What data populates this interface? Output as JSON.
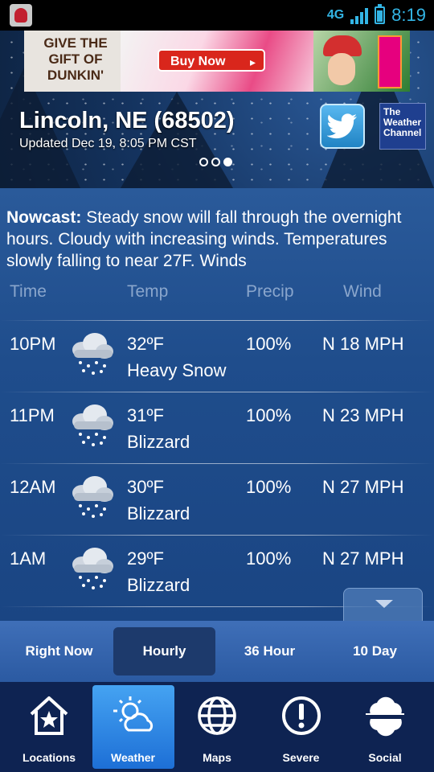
{
  "status_bar": {
    "network": "4G",
    "time": "8:19"
  },
  "ad": {
    "headline": "GIVE THE GIFT OF DUNKIN'",
    "button": "Buy Now"
  },
  "location": {
    "city": "Lincoln, NE (68502)",
    "updated": "Updated Dec 19, 8:05 PM CST",
    "page_count": 3,
    "active_page": 3
  },
  "brand": {
    "twc_line1": "The",
    "twc_line2": "Weather",
    "twc_line3": "Channel"
  },
  "nowcast": {
    "label": "Nowcast:",
    "text": "Steady snow will fall through the overnight hours. Cloudy with increasing winds. Temperatures slowly falling to near 27F. Winds"
  },
  "columns": {
    "time": "Time",
    "temp": "Temp",
    "precip": "Precip",
    "wind": "Wind"
  },
  "hourly": [
    {
      "time": "10PM",
      "temp": "32ºF",
      "condition": "Heavy Snow",
      "precip": "100%",
      "wind": "N 18 MPH",
      "icon": "heavy-snow-icon"
    },
    {
      "time": "11PM",
      "temp": "31ºF",
      "condition": "Blizzard",
      "precip": "100%",
      "wind": "N 23 MPH",
      "icon": "blizzard-icon"
    },
    {
      "time": "12AM",
      "temp": "30ºF",
      "condition": "Blizzard",
      "precip": "100%",
      "wind": "N 27 MPH",
      "icon": "blizzard-icon"
    },
    {
      "time": "1AM",
      "temp": "29ºF",
      "condition": "Blizzard",
      "precip": "100%",
      "wind": "N 27 MPH",
      "icon": "blizzard-icon"
    }
  ],
  "tabs": [
    {
      "label": "Right Now",
      "active": false
    },
    {
      "label": "Hourly",
      "active": true
    },
    {
      "label": "36 Hour",
      "active": false
    },
    {
      "label": "10 Day",
      "active": false
    }
  ],
  "nav": [
    {
      "label": "Locations",
      "icon": "house-star-icon",
      "active": false
    },
    {
      "label": "Weather",
      "icon": "sun-cloud-icon",
      "active": true
    },
    {
      "label": "Maps",
      "icon": "globe-icon",
      "active": false
    },
    {
      "label": "Severe",
      "icon": "alert-icon",
      "active": false
    },
    {
      "label": "Social",
      "icon": "social-cloud-icon",
      "active": false
    }
  ],
  "colors": {
    "accent": "#33b5e5",
    "nav_bg": "#0e2352",
    "active_nav": "#2f8ae6"
  }
}
